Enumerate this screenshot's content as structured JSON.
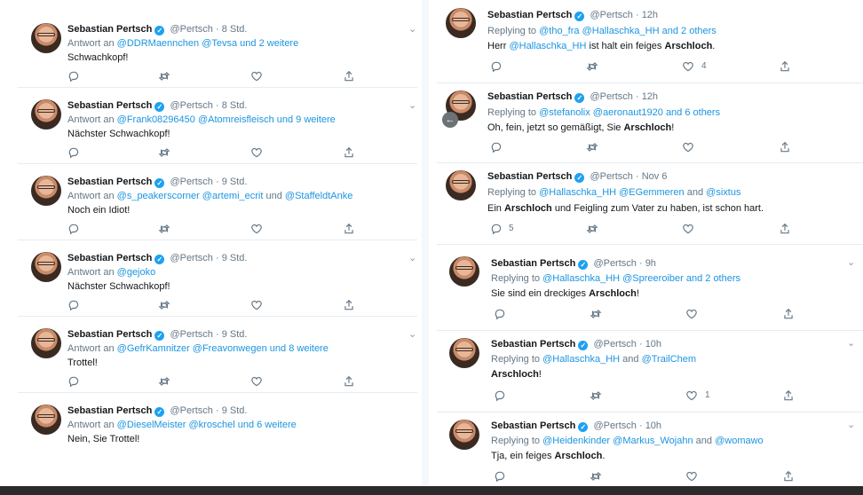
{
  "left_column": {
    "tweets": [
      {
        "name": "Sebastian Pertsch",
        "handle": "@Pertsch",
        "time": "· 8 Std.",
        "reply_prefix": "Antwort an",
        "reply_targets": "@DDRMaennchen @Tevsa",
        "reply_suffix": "und 2 weitere",
        "text": "Schwachkopf!"
      },
      {
        "name": "Sebastian Pertsch",
        "handle": "@Pertsch",
        "time": "· 8 Std.",
        "reply_prefix": "Antwort an",
        "reply_targets": "@Frank08296450 @Atomreisfleisch",
        "reply_suffix": "und 9 weitere",
        "text": "Nächster Schwachkopf!"
      },
      {
        "name": "Sebastian Pertsch",
        "handle": "@Pertsch",
        "time": "· 9 Std.",
        "reply_prefix": "Antwort an",
        "reply_targets": "@s_peakerscorner @artemi_ecrit",
        "reply_mid": "und",
        "reply_targets2": "@StaffeldtAnke",
        "text": "Noch ein Idiot!"
      },
      {
        "name": "Sebastian Pertsch",
        "handle": "@Pertsch",
        "time": "· 9 Std.",
        "reply_prefix": "Antwort an",
        "reply_targets": "@gejoko",
        "text": "Nächster Schwachkopf!"
      },
      {
        "name": "Sebastian Pertsch",
        "handle": "@Pertsch",
        "time": "· 9 Std.",
        "reply_prefix": "Antwort an",
        "reply_targets": "@GefrKamnitzer @Freavonwegen",
        "reply_suffix": "und 8 weitere",
        "text": "Trottel!"
      },
      {
        "name": "Sebastian Pertsch",
        "handle": "@Pertsch",
        "time": "· 9 Std.",
        "reply_prefix": "Antwort an",
        "reply_targets": "@DieselMeister @kroschel",
        "reply_suffix": "und 6 weitere",
        "text": "Nein, Sie Trottel!"
      }
    ]
  },
  "right_column": {
    "tweets": [
      {
        "name": "Sebastian Pertsch",
        "handle": "@Pertsch",
        "time": "· 12h",
        "reply_prefix": "Replying to",
        "reply_targets": "@tho_fra @Hallaschka_HH",
        "reply_suffix": "and 2 others",
        "text_a": "Herr ",
        "text_link": "@Hallaschka_HH",
        "text_b": " ist halt ein feiges ",
        "text_bold": "Arschloch",
        "text_c": ".",
        "like_count": "4"
      },
      {
        "name": "Sebastian Pertsch",
        "handle": "@Pertsch",
        "time": "· 12h",
        "reply_prefix": "Replying to",
        "reply_targets": "@stefanolix @aeronaut1920",
        "reply_suffix": "and 6 others",
        "text_a": "Oh, fein, jetzt so gemäßigt, Sie ",
        "text_bold": "Arschloch",
        "text_c": "!"
      },
      {
        "name": "Sebastian Pertsch",
        "handle": "@Pertsch",
        "time": "· Nov 6",
        "reply_prefix": "Replying to",
        "reply_targets": "@Hallaschka_HH @EGemmeren",
        "reply_mid": "and",
        "reply_targets2": "@sixtus",
        "text_a": "Ein ",
        "text_bold": "Arschloch",
        "text_c": " und Feigling zum Vater zu haben, ist schon hart.",
        "reply_count": "5"
      },
      {
        "name": "Sebastian Pertsch",
        "handle": "@Pertsch",
        "time": "· 9h",
        "reply_prefix": "Replying to",
        "reply_targets": "@Hallaschka_HH @Spreeroiber",
        "reply_suffix": "and 2 others",
        "text_a": "Sie sind ein dreckiges ",
        "text_bold": "Arschloch",
        "text_c": "!"
      },
      {
        "name": "Sebastian Pertsch",
        "handle": "@Pertsch",
        "time": "· 10h",
        "reply_prefix": "Replying to",
        "reply_targets": "@Hallaschka_HH",
        "reply_mid": "and",
        "reply_targets2": "@TrailChem",
        "text_bold": "Arschloch",
        "text_c": "!",
        "like_count": "1"
      },
      {
        "name": "Sebastian Pertsch",
        "handle": "@Pertsch",
        "time": "· 10h",
        "reply_prefix": "Replying to",
        "reply_targets": "@Heidenkinder @Markus_Wojahn",
        "reply_mid": "and",
        "reply_targets2": "@womawo",
        "text_a": "Tja, ein feiges ",
        "text_bold": "Arschloch",
        "text_c": "."
      }
    ]
  },
  "icons": {
    "verified": "verified-badge-icon",
    "reply": "reply-icon",
    "retweet": "retweet-icon",
    "like": "like-icon",
    "share": "share-icon",
    "more": "chevron-down-icon",
    "back": "back-arrow-icon"
  },
  "colors": {
    "link": "#1b95e0",
    "meta": "#657786",
    "text": "#14171a",
    "verified": "#1da1f2"
  }
}
